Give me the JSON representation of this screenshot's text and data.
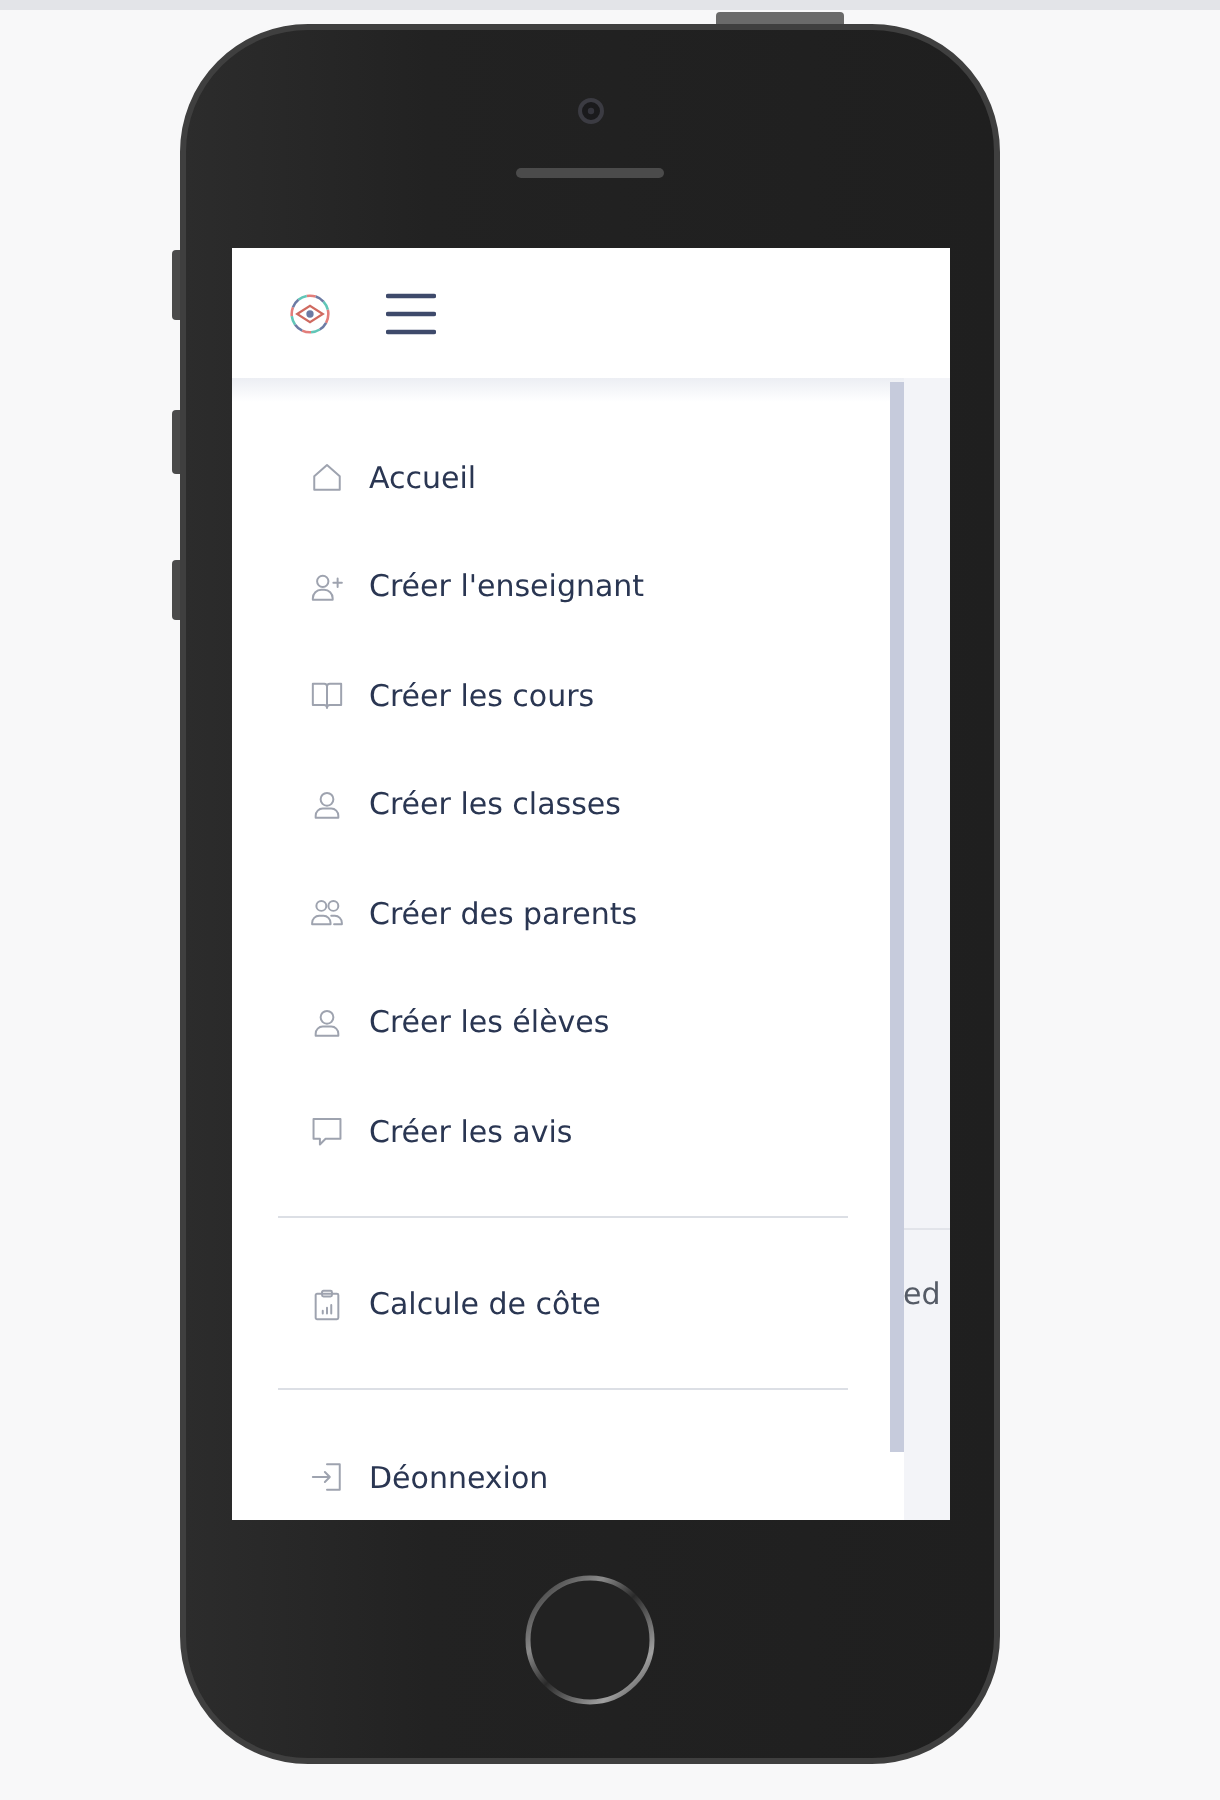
{
  "sidebar": {
    "sections": [
      {
        "items": [
          {
            "label": "Accueil",
            "kind": "home"
          },
          {
            "label": "Créer l'enseignant",
            "kind": "useradd"
          },
          {
            "label": "Créer les cours",
            "kind": "book"
          },
          {
            "label": "Créer les classes",
            "kind": "user"
          },
          {
            "label": "Créer des parents",
            "kind": "group"
          },
          {
            "label": "Créer les élèves",
            "kind": "user"
          },
          {
            "label": "Créer les avis",
            "kind": "comment"
          }
        ]
      },
      {
        "items": [
          {
            "label": "Calcule de côte",
            "kind": "report"
          }
        ]
      },
      {
        "items": [
          {
            "label": "Déonnexion",
            "kind": "signin"
          }
        ]
      }
    ]
  },
  "page_behind": {
    "text": "ed"
  }
}
